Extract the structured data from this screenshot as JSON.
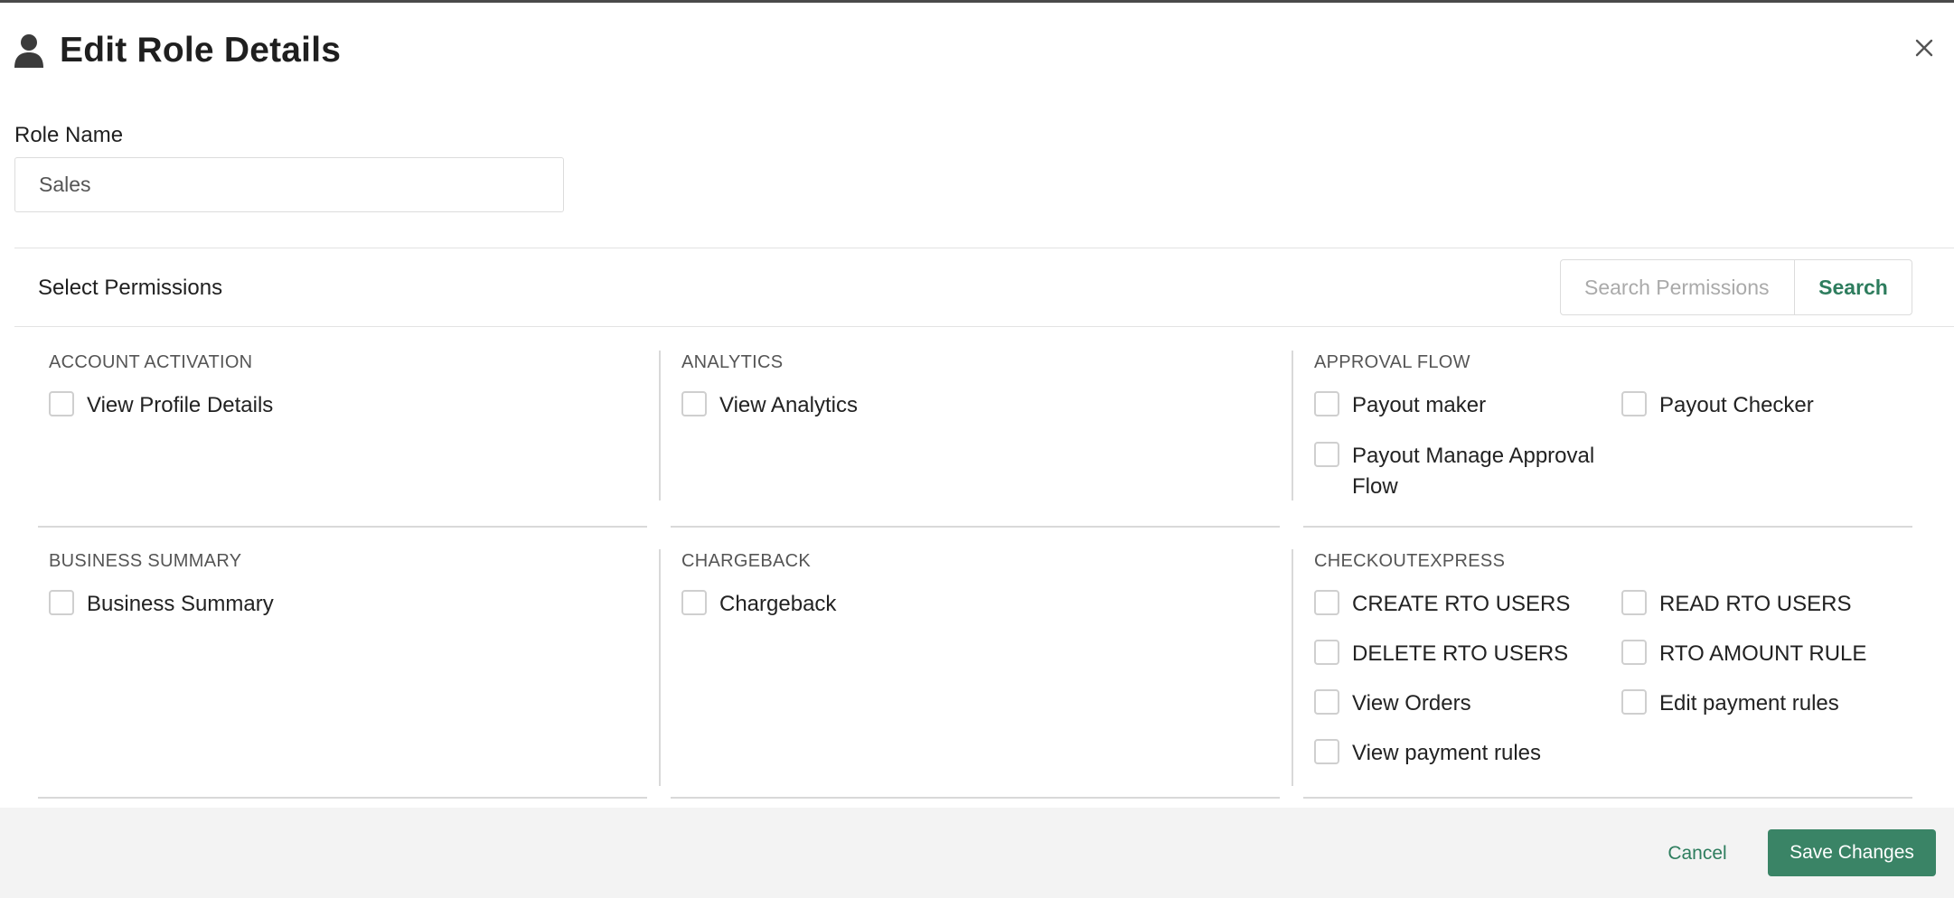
{
  "dialog": {
    "title": "Edit Role Details",
    "icons": {
      "title": "person-icon",
      "close": "close-icon"
    }
  },
  "role": {
    "label": "Role Name",
    "value": "Sales"
  },
  "permissions": {
    "section_title": "Select Permissions",
    "search_placeholder": "Search Permissions",
    "search_button": "Search",
    "groups": [
      {
        "title": "ACCOUNT ACTIVATION",
        "items": [
          "View Profile Details"
        ]
      },
      {
        "title": "ANALYTICS",
        "items": [
          "View Analytics"
        ]
      },
      {
        "title": "APPROVAL FLOW",
        "items": [
          "Payout maker",
          "Payout Checker",
          "Payout Manage Approval Flow"
        ]
      },
      {
        "title": "BUSINESS SUMMARY",
        "items": [
          "Business Summary"
        ]
      },
      {
        "title": "CHARGEBACK",
        "items": [
          "Chargeback"
        ]
      },
      {
        "title": "CHECKOUTEXPRESS",
        "items": [
          "CREATE RTO USERS",
          "READ RTO USERS",
          "DELETE RTO USERS",
          "RTO AMOUNT RULE",
          "View Orders",
          "Edit payment rules",
          "View payment rules"
        ]
      }
    ]
  },
  "footer": {
    "cancel": "Cancel",
    "save": "Save Changes"
  },
  "colors": {
    "accent": "#3a8466",
    "accent_text": "#2e7d5e",
    "footer_bg": "#f3f3f3"
  }
}
